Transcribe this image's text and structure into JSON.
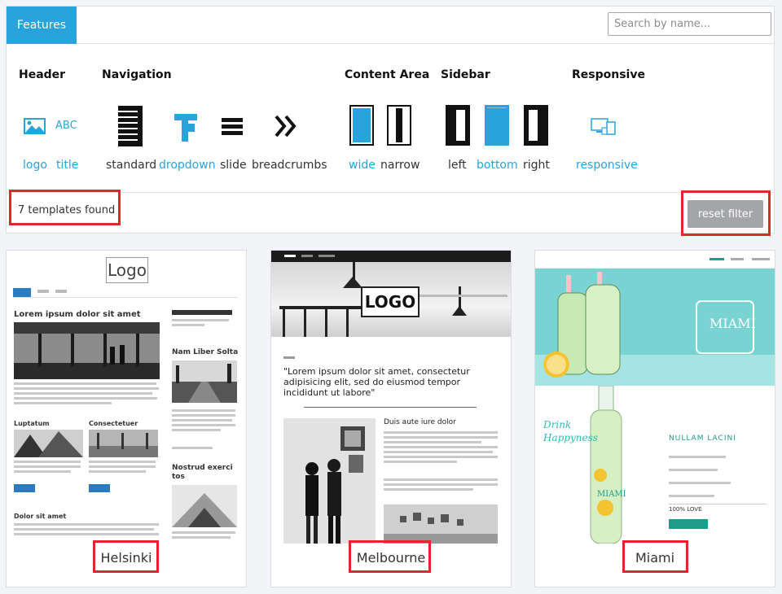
{
  "tab": {
    "label": "Features"
  },
  "search": {
    "placeholder": "Search by name..."
  },
  "filters": {
    "header": {
      "label": "Header",
      "options": [
        "logo",
        "title"
      ],
      "icon_text": "ABC"
    },
    "navigation": {
      "label": "Navigation",
      "options": [
        "standard",
        "dropdown",
        "slide",
        "breadcrumbs"
      ]
    },
    "content_area": {
      "label": "Content Area",
      "options": [
        "wide",
        "narrow"
      ]
    },
    "sidebar": {
      "label": "Sidebar",
      "options": [
        "left",
        "bottom",
        "right"
      ]
    },
    "responsive": {
      "label": "Responsive",
      "options": [
        "responsive"
      ]
    }
  },
  "results": {
    "count_text": "7 templates found",
    "reset_label": "reset filter"
  },
  "templates": [
    {
      "name": "Helsinki",
      "preview": {
        "logo": "Logo",
        "h1": "Lorem ipsum dolor sit amet",
        "h2": "Luptatum",
        "h3": "Consectetuer",
        "h4": "Dolor sit amet",
        "side1": "Nam Liber Solta",
        "side2": "Nostrud exerci tos"
      }
    },
    {
      "name": "Melbourne",
      "preview": {
        "logo": "LOGO",
        "quote": "\"Lorem ipsum dolor sit amet, consectetur adipisicing elit, sed do eiusmod tempor incididunt ut labore\"",
        "sub": "Duis aute iure dolor"
      }
    },
    {
      "name": "Miami",
      "preview": {
        "brand": "MIAMI",
        "tag": "Drink Happyness",
        "h": "NULLAM LACINI",
        "love": "100% LOVE"
      }
    }
  ],
  "colors": {
    "accent": "#29a3dc",
    "highlight": "#e0272d",
    "reset_button": "#a4a5a9"
  }
}
